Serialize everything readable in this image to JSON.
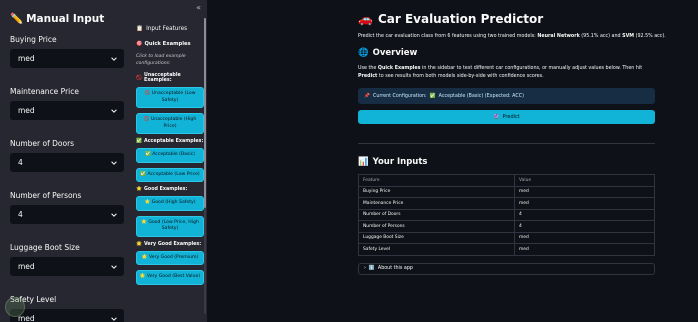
{
  "sidebar_left": {
    "title": "Manual Input",
    "title_icon": "pencil-icon",
    "fields": [
      {
        "label": "Buying Price",
        "value": "med"
      },
      {
        "label": "Maintenance Price",
        "value": "med"
      },
      {
        "label": "Number of Doors",
        "value": "4"
      },
      {
        "label": "Number of Persons",
        "value": "4"
      },
      {
        "label": "Luggage Boot Size",
        "value": "med"
      },
      {
        "label": "Safety Level",
        "value": "med"
      }
    ]
  },
  "sidebar_right": {
    "collapse": "«",
    "title": "Input Features",
    "quick_title": "Quick Examples",
    "hint": "Click to load example configurations:",
    "groups": [
      {
        "heading": "Unacceptable Examples:",
        "buttons": [
          "Unacceptable (Low Safety)",
          "Unacceptable (High Price)"
        ]
      },
      {
        "heading": "Acceptable Examples:",
        "buttons": [
          "Acceptable (Basic)",
          "Acceptable (Low Price)"
        ]
      },
      {
        "heading": "Good Examples:",
        "buttons": [
          "Good (High Safety)",
          "Good (Low Price, High Safety)"
        ]
      },
      {
        "heading": "Very Good Examples:",
        "buttons": [
          "Very Good (Premium)",
          "Very Good (Best Value)"
        ]
      }
    ]
  },
  "main": {
    "title": "Car Evaluation Predictor",
    "intro_prefix": "Predict the car evaluation class from 6 features using two trained models: ",
    "intro_model1": "Neural Network",
    "intro_model1_score": " (95.1% acc)",
    "intro_and": " and ",
    "intro_model2": "SVM",
    "intro_model2_score": " (92.5% acc).",
    "overview_title": "Overview",
    "overview_prefix": "Use the ",
    "overview_bold1": "Quick Examples",
    "overview_mid": " in the sidebar to test different car configurations, or manually adjust values below. Then hit ",
    "overview_bold2": "Predict",
    "overview_suffix": " to see results from both models side-by-side with confidence scores.",
    "config_label": "Current Configuration:",
    "config_value": "Acceptable (Basic) (Expected: ACC)",
    "predict_label": "Predict",
    "inputs_title": "Your Inputs",
    "table_headers": [
      "Feature",
      "Value"
    ],
    "table_rows": [
      [
        "Buying Price",
        "med"
      ],
      [
        "Maintenance Price",
        "med"
      ],
      [
        "Number of Doors",
        "4"
      ],
      [
        "Number of Persons",
        "4"
      ],
      [
        "Luggage Boot Size",
        "med"
      ],
      [
        "Safety Level",
        "med"
      ]
    ],
    "about_label": "About this app"
  },
  "colors": {
    "background": "#0e1117",
    "sidebar": "#262730",
    "accent": "#11b3d6",
    "info_box": "#172d43"
  }
}
